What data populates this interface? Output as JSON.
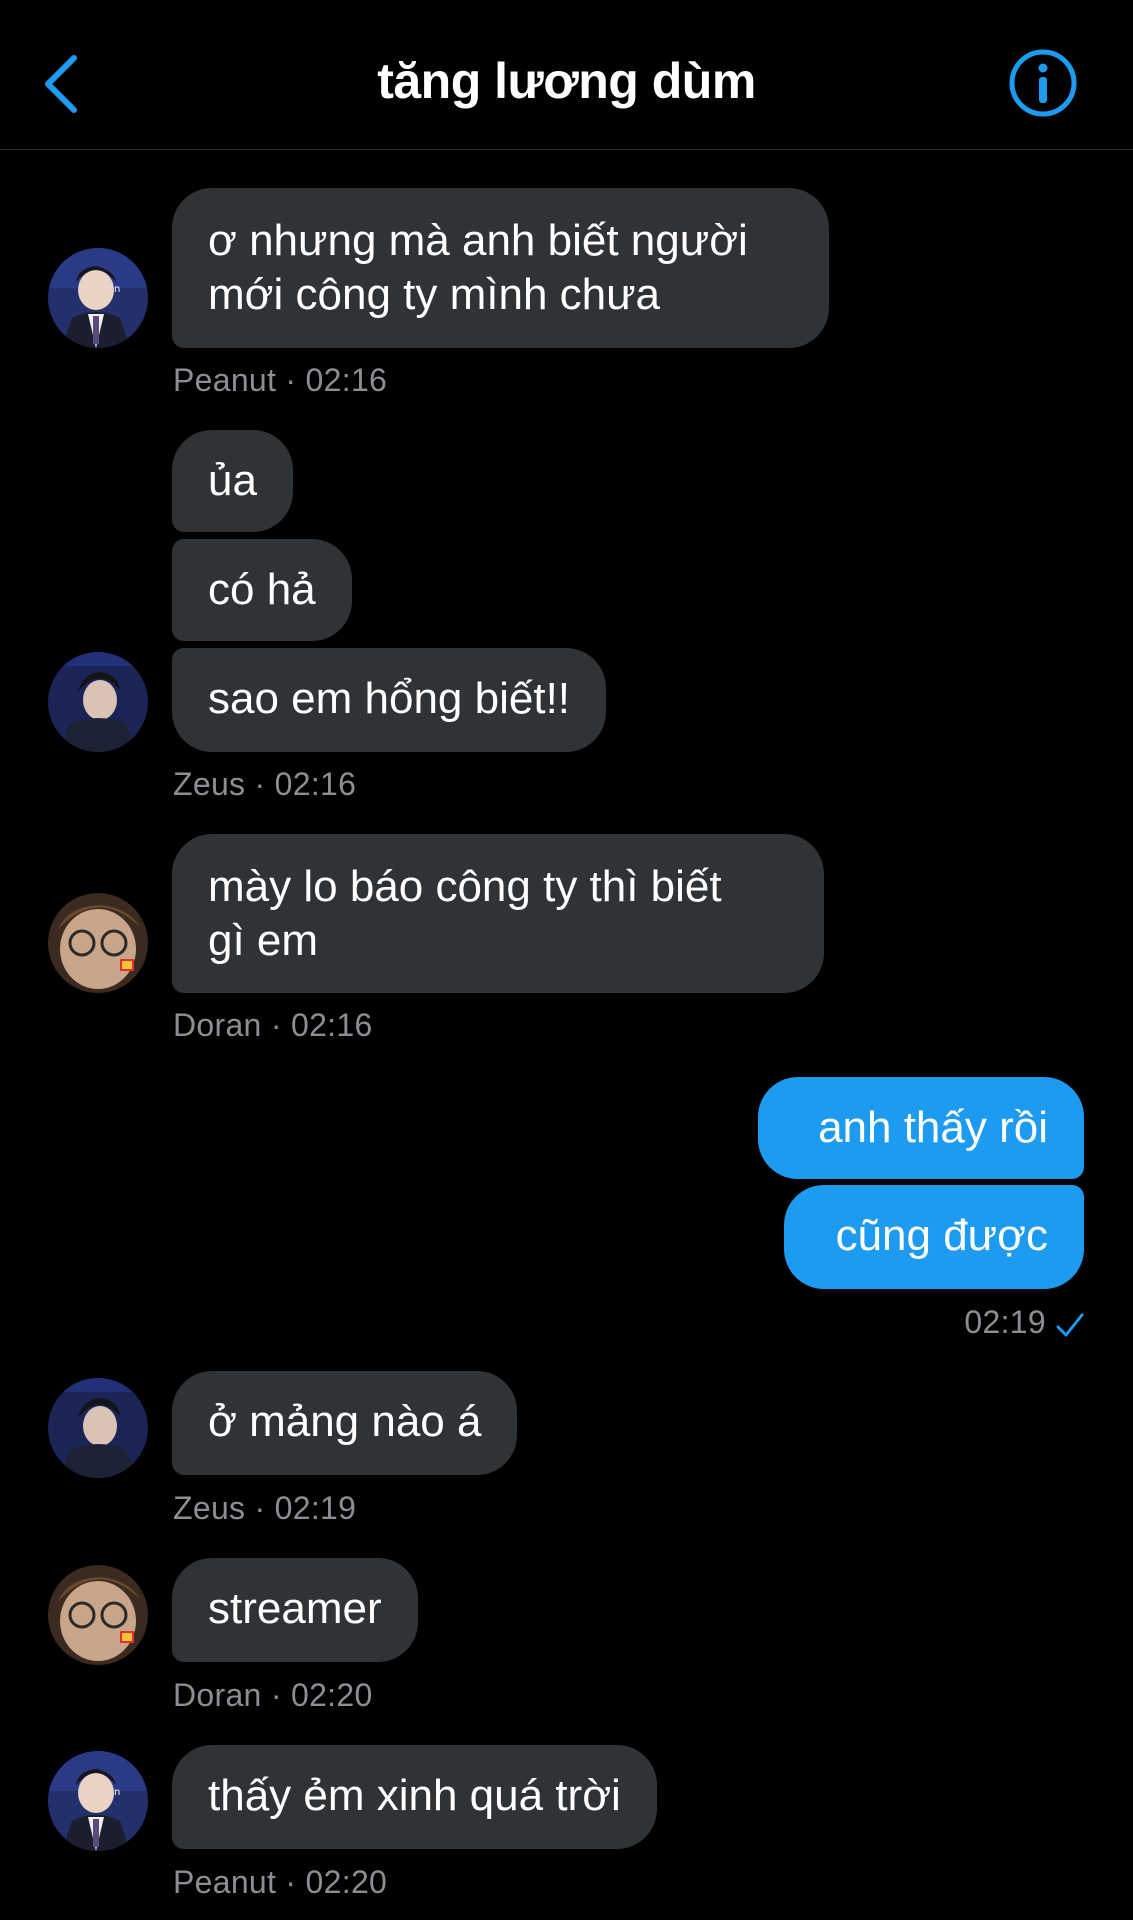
{
  "header": {
    "title": "tăng lương dùm",
    "back_icon": "chevron-left-icon",
    "info_icon": "info-circle-icon",
    "accent_color": "#1d9bf0"
  },
  "messages": [
    {
      "sender": "Peanut",
      "text_lines": [
        "ơ nhưng mà anh biết người",
        "mới công ty mình chưa"
      ],
      "meta": "Peanut · 02:16"
    },
    {
      "sender": "Zeus",
      "texts": [
        "ủa",
        "có hả",
        "sao em hổng biết!!"
      ],
      "meta": "Zeus · 02:16"
    },
    {
      "sender": "Doran",
      "text_lines": [
        "mày lo báo công ty thì biết",
        "gì em"
      ],
      "meta": "Doran · 02:16"
    },
    {
      "sender": "me",
      "texts": [
        "anh thấy rồi",
        "cũng được"
      ],
      "meta": "02:19",
      "status_icon": "sent-check-icon"
    },
    {
      "sender": "Zeus",
      "texts": [
        "ở mảng nào á"
      ],
      "meta": "Zeus · 02:19"
    },
    {
      "sender": "Doran",
      "texts": [
        "streamer"
      ],
      "meta": "Doran · 02:20"
    },
    {
      "sender": "Peanut",
      "texts": [
        "thấy ẻm xinh quá trời"
      ],
      "meta": "Peanut · 02:20"
    }
  ]
}
